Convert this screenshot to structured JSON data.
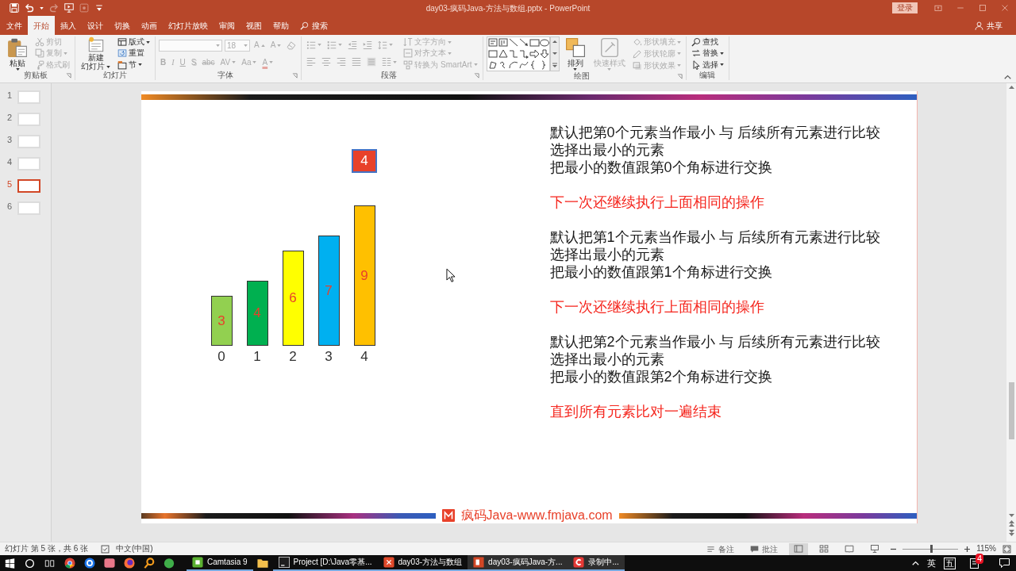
{
  "window": {
    "title": "day03-疯码Java-方法与数组.pptx - PowerPoint",
    "sign_in": "登录",
    "share": "共享"
  },
  "quick_access": [
    {
      "kind": "save",
      "disabled": false
    },
    {
      "kind": "undo",
      "disabled": false
    },
    {
      "kind": "redo",
      "disabled": true
    },
    {
      "kind": "present",
      "disabled": false
    },
    {
      "kind": "touch",
      "disabled": true
    },
    {
      "kind": "customize",
      "disabled": false
    }
  ],
  "tabs": [
    {
      "label": "文件",
      "selected": false
    },
    {
      "label": "开始",
      "selected": true
    },
    {
      "label": "插入",
      "selected": false
    },
    {
      "label": "设计",
      "selected": false
    },
    {
      "label": "切换",
      "selected": false
    },
    {
      "label": "动画",
      "selected": false
    },
    {
      "label": "幻灯片放映",
      "selected": false
    },
    {
      "label": "审阅",
      "selected": false
    },
    {
      "label": "视图",
      "selected": false
    },
    {
      "label": "帮助",
      "selected": false
    }
  ],
  "tell_me": {
    "label": "搜索"
  },
  "ribbon": {
    "groups": [
      {
        "label": "剪贴板",
        "launcher": true,
        "columns": [
          [
            [
              {
                "kind": "paste",
                "label": "粘贴",
                "dropdown": true,
                "disabled": false
              }
            ]
          ],
          [
            [
              {
                "kind": "cut",
                "label": "剪切",
                "dropdown": false,
                "disabled": true
              }
            ],
            [
              {
                "kind": "copy",
                "label": "复制",
                "dropdown": true,
                "disabled": true
              }
            ],
            [
              {
                "kind": "brush",
                "label": "格式刷",
                "dropdown": false,
                "disabled": true
              }
            ]
          ]
        ]
      },
      {
        "label": "幻灯片",
        "launcher": false,
        "columns": [
          [
            [
              {
                "kind": "newslide",
                "lines": [
                  "新建",
                  "幻灯片"
                ],
                "dropdown": true,
                "disabled": false
              }
            ]
          ],
          [
            [
              {
                "kind": "layout",
                "label": "版式",
                "dropdown": true,
                "disabled": false
              }
            ],
            [
              {
                "kind": "reset",
                "label": "重置",
                "dropdown": false,
                "disabled": false
              }
            ],
            [
              {
                "kind": "section",
                "label": "节",
                "dropdown": true,
                "disabled": false
              }
            ]
          ]
        ]
      },
      {
        "label": "字体",
        "launcher": true,
        "columns": [
          [
            [
              {
                "kind": "fontname",
                "dropdown": true,
                "disabled": true
              },
              {
                "kind": "fontsize",
                "value": "18",
                "dropdown": true,
                "disabled": true
              },
              {
                "kind": "grow",
                "label": "A",
                "dropdown": false,
                "disabled": true
              },
              {
                "kind": "shrink",
                "label": "A",
                "dropdown": false,
                "disabled": true
              },
              {
                "kind": "clear",
                "dropdown": false,
                "disabled": true
              }
            ],
            [
              {
                "kind": "bold",
                "label": "B",
                "dropdown": false,
                "disabled": true
              },
              {
                "kind": "italic",
                "label": "I",
                "dropdown": false,
                "disabled": true
              },
              {
                "kind": "underline",
                "label": "U",
                "dropdown": false,
                "disabled": true
              },
              {
                "kind": "shadow",
                "label": "S",
                "dropdown": false,
                "disabled": true
              },
              {
                "kind": "strike",
                "label": "abc",
                "dropdown": false,
                "disabled": true
              },
              {
                "kind": "spacing",
                "label": "AV",
                "dropdown": true,
                "disabled": true
              },
              {
                "kind": "case",
                "label": "Aa",
                "dropdown": true,
                "disabled": true
              },
              {
                "kind": "color",
                "label": "A",
                "dropdown": true,
                "disabled": true
              }
            ]
          ]
        ]
      },
      {
        "label": "段落",
        "launcher": true,
        "columns": [
          [
            [
              {
                "kind": "bullets",
                "dropdown": true,
                "disabled": true
              },
              {
                "kind": "numbering",
                "dropdown": true,
                "disabled": true
              },
              {
                "kind": "outdent",
                "dropdown": false,
                "disabled": true
              },
              {
                "kind": "indent",
                "dropdown": false,
                "disabled": true
              },
              {
                "kind": "linespacing",
                "dropdown": true,
                "disabled": true
              }
            ],
            [
              {
                "kind": "left",
                "dropdown": false,
                "disabled": true
              },
              {
                "kind": "center",
                "dropdown": false,
                "disabled": true
              },
              {
                "kind": "right",
                "dropdown": false,
                "disabled": true
              },
              {
                "kind": "justify",
                "dropdown": false,
                "disabled": true
              },
              {
                "kind": "distribute",
                "dropdown": false,
                "disabled": true
              },
              {
                "kind": "columns",
                "dropdown": true,
                "disabled": true
              }
            ]
          ],
          [
            [
              {
                "kind": "textdir",
                "label": "文字方向",
                "dropdown": true,
                "disabled": true
              }
            ],
            [
              {
                "kind": "aligntext",
                "label": "对齐文本",
                "dropdown": true,
                "disabled": true
              }
            ],
            [
              {
                "kind": "smartart",
                "label": "转换为 SmartArt",
                "dropdown": true,
                "disabled": true
              }
            ]
          ]
        ]
      },
      {
        "label": "绘图",
        "launcher": true,
        "columns": [
          [
            [
              {
                "kind": "gallery",
                "dropdown": false,
                "disabled": false
              }
            ]
          ],
          [
            [
              {
                "kind": "arrange",
                "label": "排列",
                "dropdown": true,
                "disabled": false
              }
            ]
          ],
          [
            [
              {
                "kind": "quickstyle",
                "label": "快速样式",
                "dropdown": true,
                "disabled": true
              }
            ]
          ],
          [
            [
              {
                "kind": "fill",
                "label": "形状填充",
                "dropdown": true,
                "disabled": true
              }
            ],
            [
              {
                "kind": "outline",
                "label": "形状轮廓",
                "dropdown": true,
                "disabled": true
              }
            ],
            [
              {
                "kind": "effects",
                "label": "形状效果",
                "dropdown": true,
                "disabled": true
              }
            ]
          ]
        ]
      },
      {
        "label": "编辑",
        "launcher": false,
        "columns": [
          [
            [
              {
                "kind": "find",
                "label": "查找",
                "dropdown": false,
                "disabled": false
              }
            ],
            [
              {
                "kind": "replace",
                "label": "替换",
                "dropdown": true,
                "disabled": false
              }
            ],
            [
              {
                "kind": "select",
                "label": "选择",
                "dropdown": true,
                "disabled": false
              }
            ]
          ]
        ]
      }
    ]
  },
  "slides": [
    {
      "number": "1",
      "selected": false
    },
    {
      "number": "2",
      "selected": false
    },
    {
      "number": "3",
      "selected": false
    },
    {
      "number": "4",
      "selected": false
    },
    {
      "number": "5",
      "selected": true
    },
    {
      "number": "6",
      "selected": false
    }
  ],
  "slide": {
    "array": [
      {
        "index": "0",
        "value": "3",
        "color": "#92d050"
      },
      {
        "index": "1",
        "value": "4",
        "color": "#00b050"
      },
      {
        "index": "2",
        "value": "6",
        "color": "#ffff00"
      },
      {
        "index": "3",
        "value": "7",
        "color": "#00b0f0"
      },
      {
        "index": "4",
        "value": "9",
        "color": "#ffc000",
        "marker": "4"
      }
    ],
    "notes": [
      {
        "kind": "step",
        "lines": [
          "默认把第0个元素当作最小 与 后续所有元素进行比较",
          "选择出最小的元素",
          "把最小的数值跟第0个角标进行交换"
        ]
      },
      {
        "kind": "highlight",
        "lines": [
          "下一次还继续执行上面相同的操作"
        ]
      },
      {
        "kind": "step",
        "lines": [
          "默认把第1个元素当作最小 与 后续所有元素进行比较",
          "选择出最小的元素",
          "把最小的数值跟第1个角标进行交换"
        ]
      },
      {
        "kind": "highlight",
        "lines": [
          "下一次还继续执行上面相同的操作"
        ]
      },
      {
        "kind": "step",
        "lines": [
          "默认把第2个元素当作最小 与 后续所有元素进行比较",
          "选择出最小的元素",
          "把最小的数值跟第2个角标进行交换"
        ]
      },
      {
        "kind": "highlight",
        "lines": [
          "直到所有元素比对一遍结束"
        ]
      }
    ],
    "footer": "疯码Java-www.fmjava.com"
  },
  "status_bar": {
    "slide_info": "幻灯片 第 5 张，共 6 张",
    "language": "中文(中国)",
    "notes": "备注",
    "comments": "批注",
    "views": [
      {
        "kind": "normal",
        "selected": true
      },
      {
        "kind": "sorter",
        "selected": false
      },
      {
        "kind": "reading",
        "selected": false
      },
      {
        "kind": "show",
        "selected": false
      }
    ],
    "zoom": {
      "level": 0.52,
      "reading": "115%"
    }
  },
  "taskbar": {
    "apps": [
      {
        "running": false,
        "selected": false
      },
      {
        "running": false,
        "selected": false
      },
      {
        "running": false,
        "selected": false
      },
      {
        "running": false,
        "selected": false
      },
      {
        "running": false,
        "selected": false
      },
      {
        "running": false,
        "selected": false
      },
      {
        "label": "Camtasia 9",
        "running": true,
        "selected": false
      },
      {
        "running": false,
        "selected": false
      },
      {
        "label": "Project [D:\\Java零基...",
        "running": true,
        "selected": false
      },
      {
        "label": "day03-方法与数组",
        "running": true,
        "selected": false
      },
      {
        "label": "day03-疯码Java-方...",
        "running": true,
        "selected": true
      },
      {
        "label": "录制中...",
        "running": true,
        "selected": true
      }
    ],
    "tray": {
      "input": "英",
      "ime": "五",
      "badge": "4"
    }
  }
}
